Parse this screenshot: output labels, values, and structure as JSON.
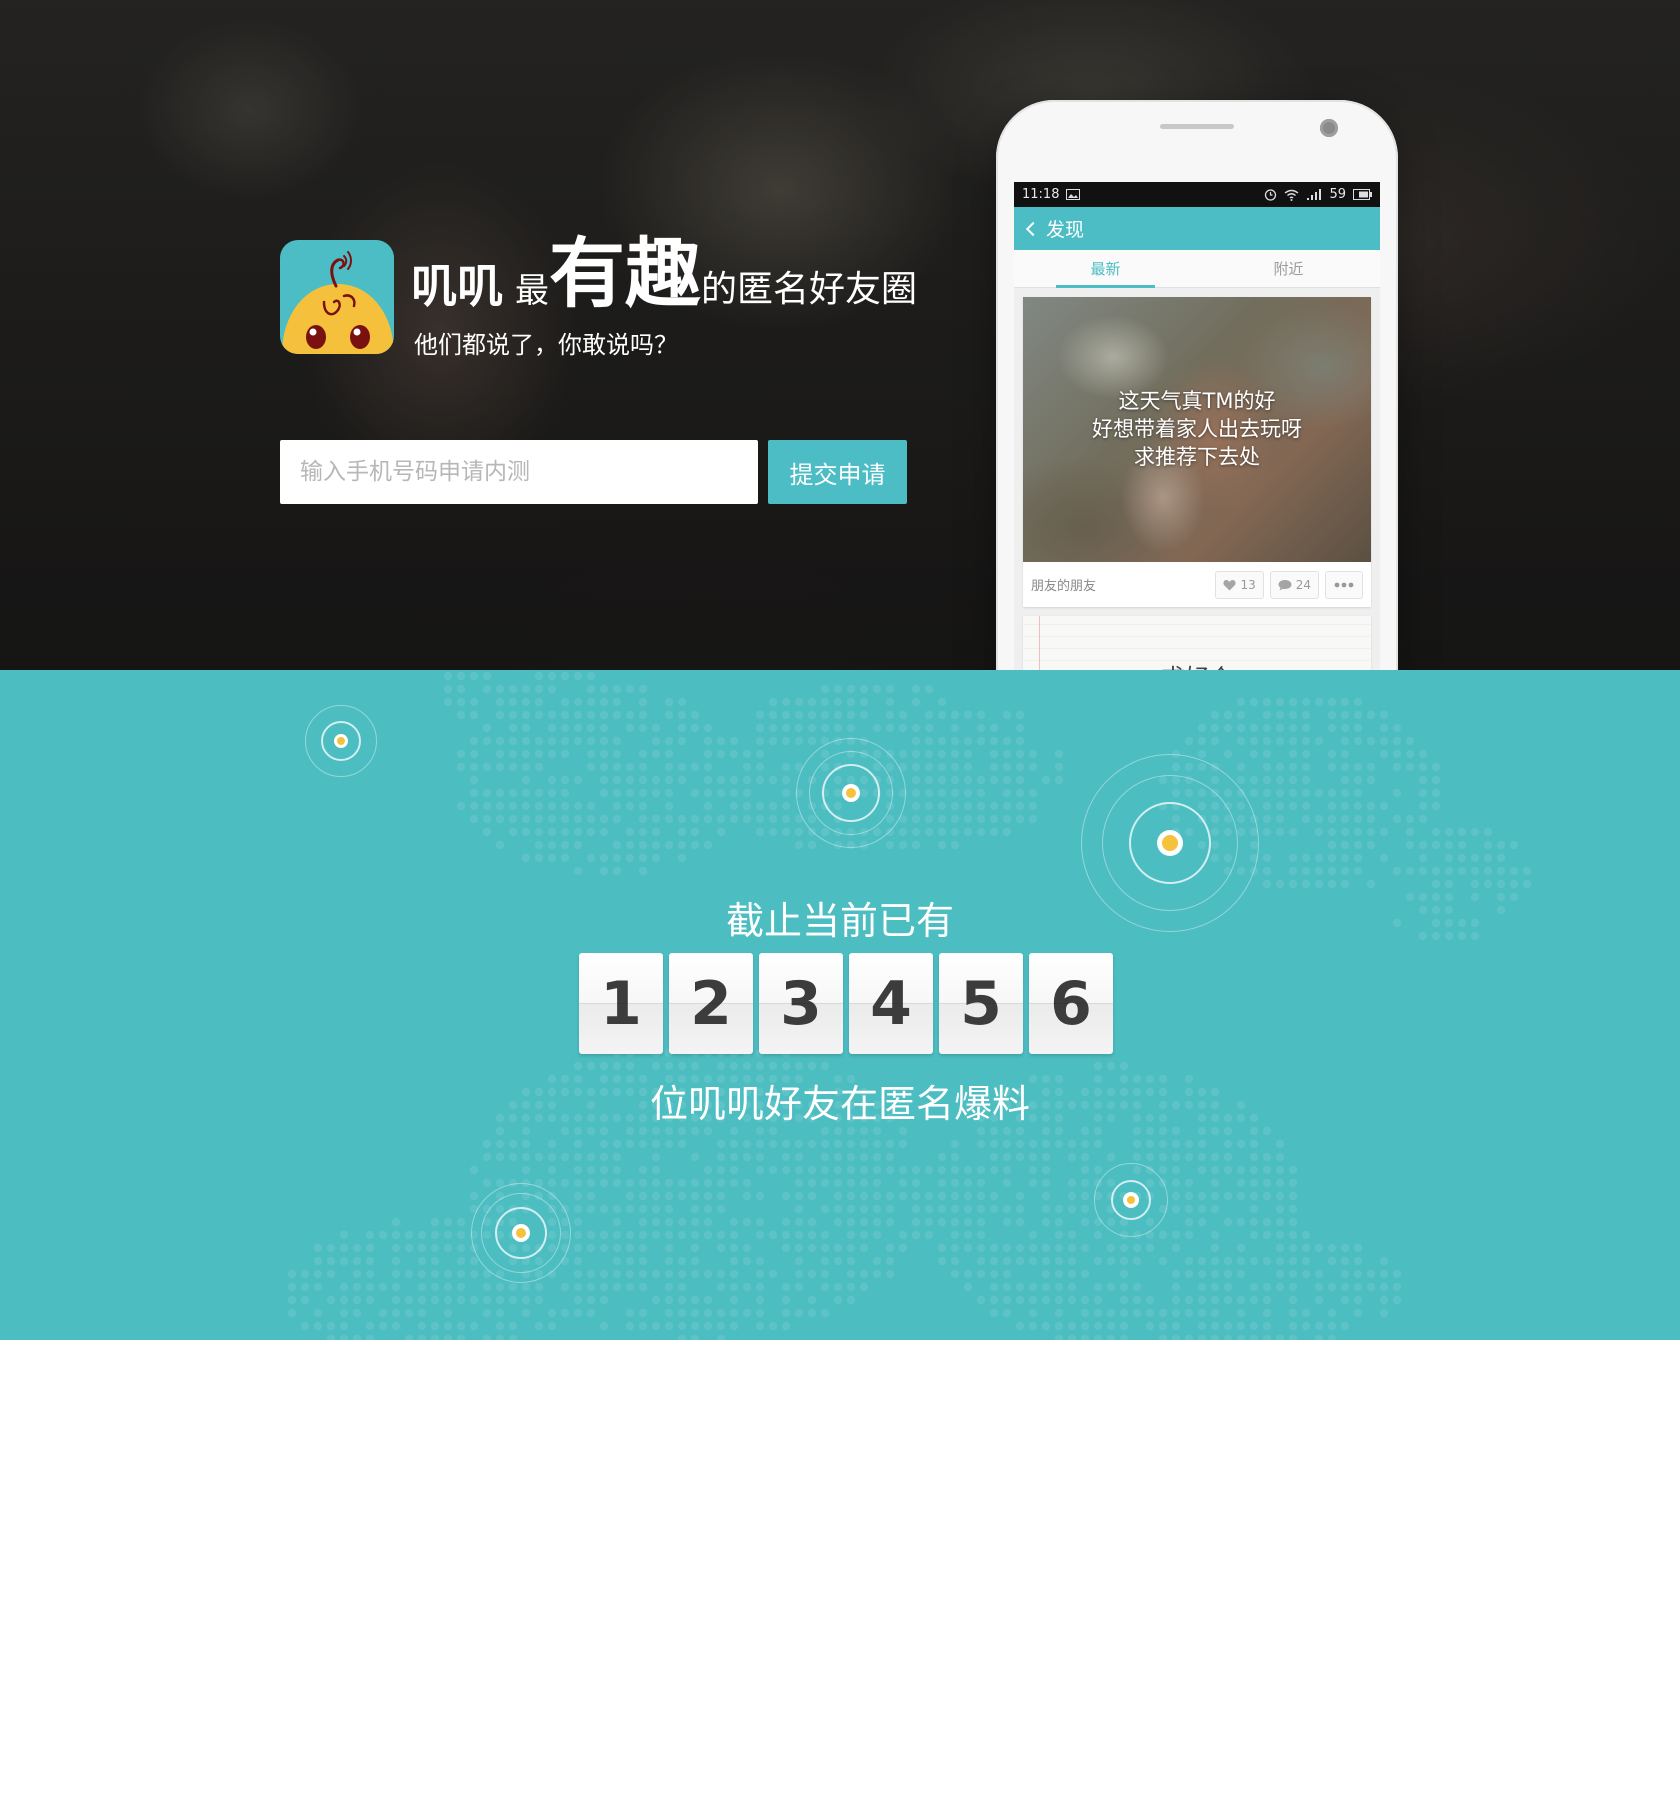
{
  "hero": {
    "brand_name": "叽叽",
    "brand_most": "最",
    "brand_fun": "有趣",
    "brand_rest": "的匿名好友圈",
    "tagline": "他们都说了，你敢说吗？",
    "phone_placeholder": "输入手机号码申请内测",
    "phone_value": "",
    "submit_label": "提交申请",
    "logo_icon": "chick-mascot-icon"
  },
  "phone_screen": {
    "status_time": "11:18",
    "status_battery": "59",
    "nav_title": "发现",
    "tabs": [
      {
        "label": "最新",
        "active": true
      },
      {
        "label": "附近",
        "active": false
      }
    ],
    "card": {
      "caption": [
        "这天气真TM的好",
        "好想带着家人出去玩呀",
        "求推荐下去处"
      ],
      "author": "朋友的朋友",
      "likes": "13",
      "comments": "24"
    },
    "card2_text": "求好个"
  },
  "stats": {
    "heading": "截止当前已有",
    "digits": [
      "1",
      "2",
      "3",
      "4",
      "5",
      "6"
    ],
    "subheading": "位叽叽好友在匿名爆料"
  },
  "colors": {
    "accent": "#4cbdc4",
    "stats_bg": "#4cbdc1",
    "ping_dot": "#f6c23c",
    "mascot_yellow": "#f5c13c",
    "mascot_eye": "#7a1010"
  }
}
